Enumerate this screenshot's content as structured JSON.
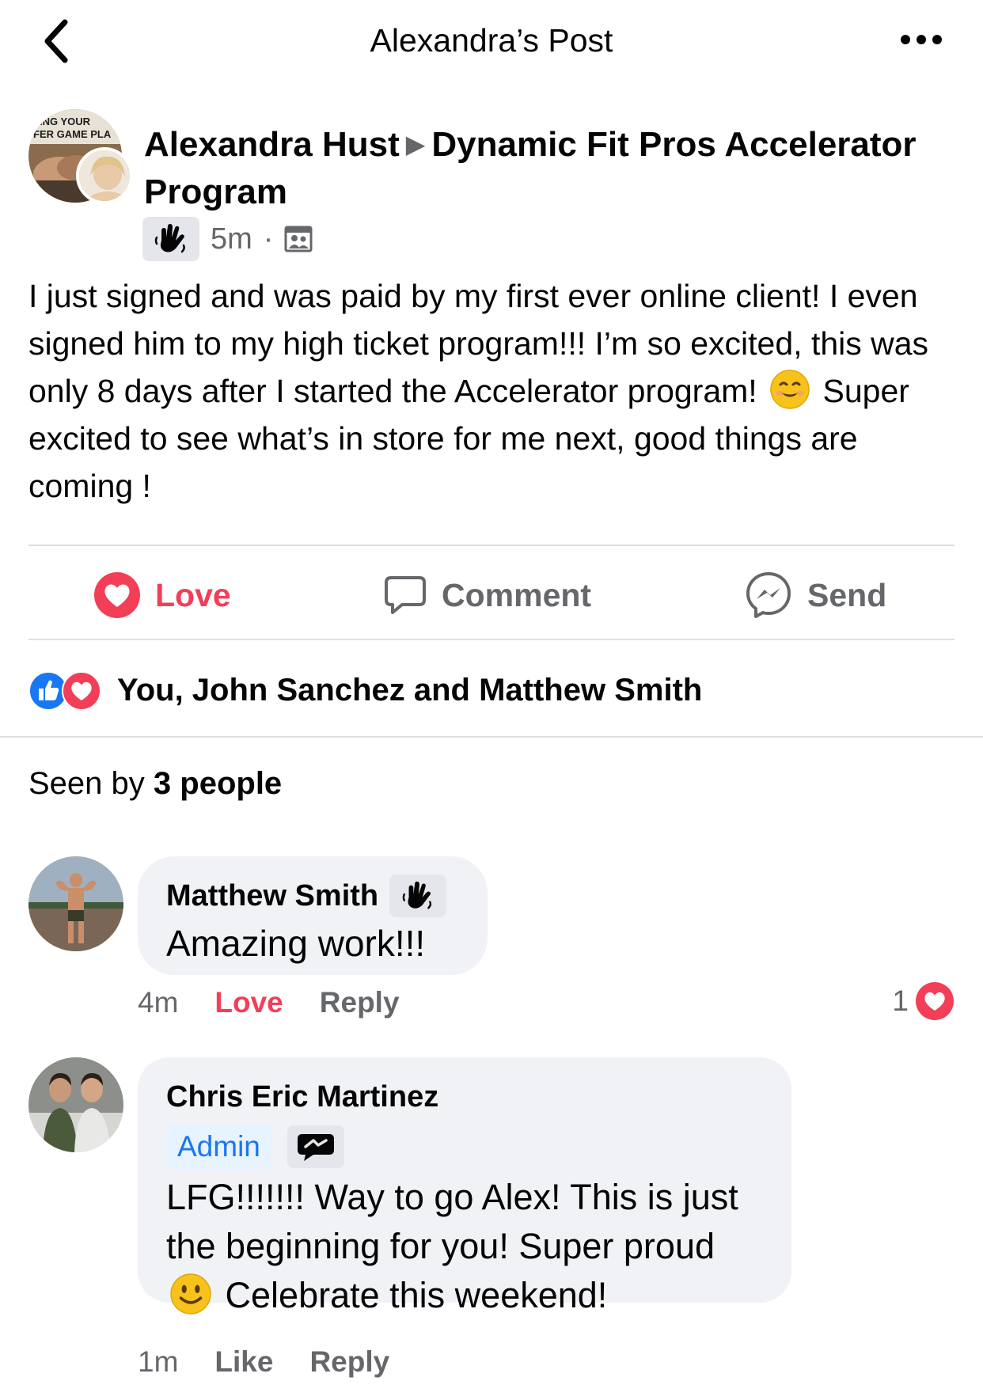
{
  "header": {
    "title": "Alexandra’s Post",
    "back_icon": "chevron-left-icon",
    "more_icon": "more-horizontal-icon"
  },
  "post": {
    "author": "Alexandra Hust",
    "group_name": "Dynamic Fit Pros Accelerator Program",
    "group_avatar_text_1": "ING YOUR",
    "group_avatar_text_2": "FER GAME PLA",
    "time": "5m",
    "separator": "·",
    "audience_icon": "group-members-icon",
    "badge_icon": "wave-hand-icon",
    "text_part1": "I just signed and was paid by my first ever online client! I even signed him to my high ticket program!!! I’m so excited, this was only 8 days after I started the Accelerator program!",
    "text_part2": "Super excited to see what’s in store for me next, good things are coming !"
  },
  "actions": {
    "love_label": "Love",
    "comment_label": "Comment",
    "send_label": "Send"
  },
  "reactions": {
    "text": "You, John Sanchez and Matthew Smith"
  },
  "seen": {
    "prefix": "Seen by",
    "count_text": "3 people"
  },
  "comments": [
    {
      "name": "Matthew Smith",
      "text": "Amazing work!!!",
      "time": "4m",
      "react_label": "Love",
      "reply_label": "Reply",
      "reaction_count": "1"
    },
    {
      "name": "Chris Eric Martinez",
      "role": "Admin",
      "text_part1": "LFG!!!!!!! Way to go Alex! This is just the beginning for you! Super proud",
      "text_part2": "Celebrate this weekend!",
      "time": "1m",
      "react_label": "Like",
      "reply_label": "Reply"
    }
  ],
  "colors": {
    "love": "#f33e58",
    "like": "#1877f2",
    "muted": "#65676b",
    "bubble": "#f0f2f5"
  }
}
